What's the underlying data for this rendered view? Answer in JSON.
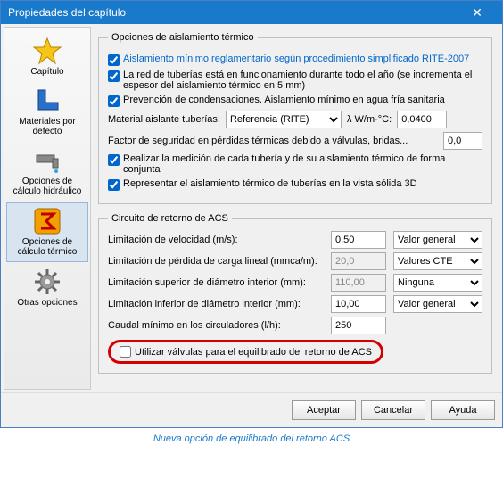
{
  "title": "Propiedades del capítulo",
  "sidebar": {
    "items": [
      {
        "label": "Capítulo"
      },
      {
        "label": "Materiales por defecto"
      },
      {
        "label": "Opciones de cálculo hidráulico"
      },
      {
        "label": "Opciones de cálculo térmico"
      },
      {
        "label": "Otras opciones"
      }
    ]
  },
  "thermal": {
    "legend": "Opciones de aislamiento térmico",
    "chk1": "Aislamiento mínimo reglamentario según procedimiento simplificado RITE-2007",
    "chk2": "La red de tuberías está en funcionamiento durante todo el año (se incrementa el espesor del aislamiento térmico en 5 mm)",
    "chk3": "Prevención de condensaciones. Aislamiento mínimo en agua fría sanitaria",
    "mat_label": "Material aislante tuberías:",
    "mat_combo": "Referencia (RITE)",
    "lambda": "λ   W/m·°C:",
    "lambda_val": "0,0400",
    "factor_label": "Factor de seguridad en pérdidas térmicas debido a válvulas, bridas...",
    "factor_val": "0,0",
    "chk4": "Realizar la medición de cada tubería y de su aislamiento térmico de forma conjunta",
    "chk5": "Representar el aislamiento térmico de tuberías en la vista sólida 3D"
  },
  "acs": {
    "legend": "Circuito de retorno de ACS",
    "rows": [
      {
        "label": "Limitación de velocidad (m/s):",
        "val": "0,50",
        "combo": "Valor general",
        "dis": false
      },
      {
        "label": "Limitación de pérdida de carga lineal (mmca/m):",
        "val": "20,0",
        "combo": "Valores CTE",
        "dis": true
      },
      {
        "label": "Limitación superior de diámetro interior (mm):",
        "val": "110,00",
        "combo": "Ninguna",
        "dis": true
      },
      {
        "label": "Limitación inferior de diámetro interior (mm):",
        "val": "10,00",
        "combo": "Valor general",
        "dis": false
      }
    ],
    "caudal_label": "Caudal mínimo en los circuladores (l/h):",
    "caudal_val": "250",
    "chk_valves": "Utilizar válvulas para el equilibrado del retorno de ACS"
  },
  "buttons": {
    "ok": "Aceptar",
    "cancel": "Cancelar",
    "help": "Ayuda"
  },
  "caption": "Nueva opción de equilibrado del retorno ACS"
}
